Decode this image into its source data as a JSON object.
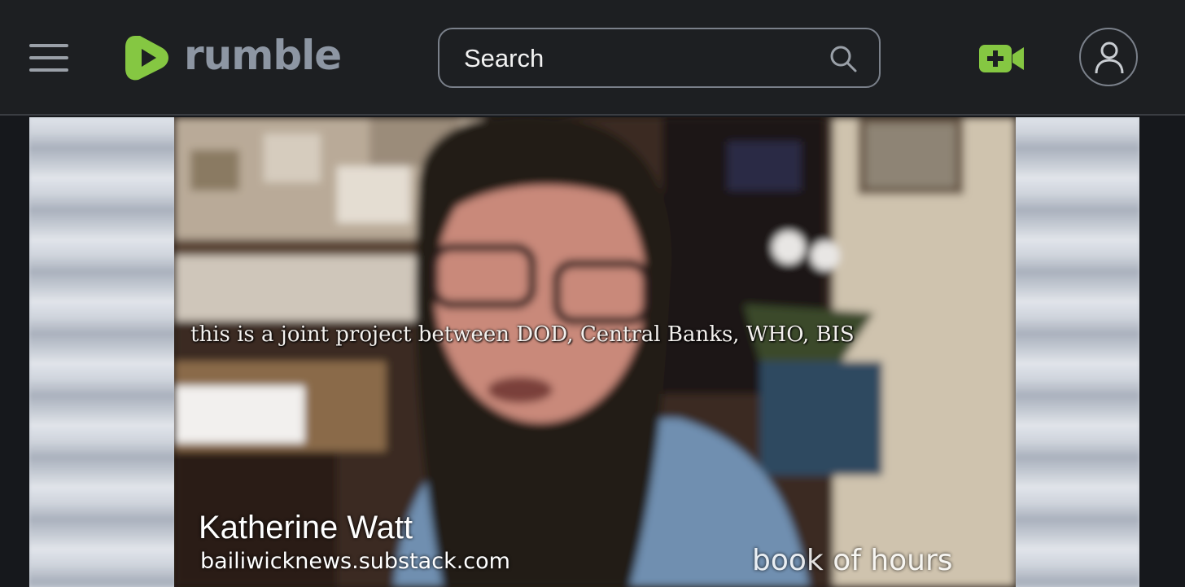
{
  "header": {
    "menu_icon": "hamburger-menu-icon",
    "logo_text": "rumble",
    "brand_color": "#85c742",
    "search": {
      "placeholder": "Search",
      "value": ""
    },
    "search_icon": "search-icon",
    "upload_icon": "video-camera-plus-icon",
    "account_icon": "user-icon"
  },
  "video": {
    "caption": "this is a joint project between DOD, Central Banks, WHO, BIS",
    "lower_third_name": "Katherine Watt",
    "lower_third_url": "bailiwicknews.substack.com",
    "watermark": "book of hours"
  }
}
